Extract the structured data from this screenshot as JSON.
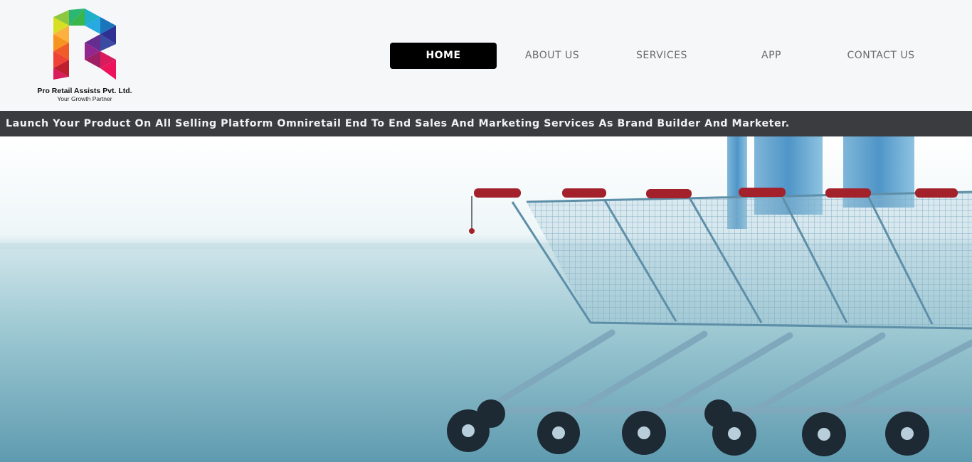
{
  "brand": {
    "company_name": "Pro Retail Assists Pvt. Ltd.",
    "tagline": "Your Growth Partner",
    "logo_icon": "r-letter-logo-icon"
  },
  "nav": {
    "items": [
      {
        "label": "HOME",
        "active": true
      },
      {
        "label": "ABOUT US",
        "active": false
      },
      {
        "label": "SERVICES",
        "active": false
      },
      {
        "label": "APP",
        "active": false
      },
      {
        "label": "CONTACT US",
        "active": false
      }
    ]
  },
  "banner": {
    "text": "Launch Your Product On All Selling Platform Omniretail End To End Sales And Marketing Services As Brand Builder And Marketer."
  },
  "hero": {
    "image": "shopping-carts-image"
  },
  "colors": {
    "header_bg": "#f6f7f9",
    "strip_bg": "#3a3c40",
    "nav_active_bg": "#000000",
    "nav_text": "#6b6b6b",
    "cart_handle": "#a3212b"
  }
}
